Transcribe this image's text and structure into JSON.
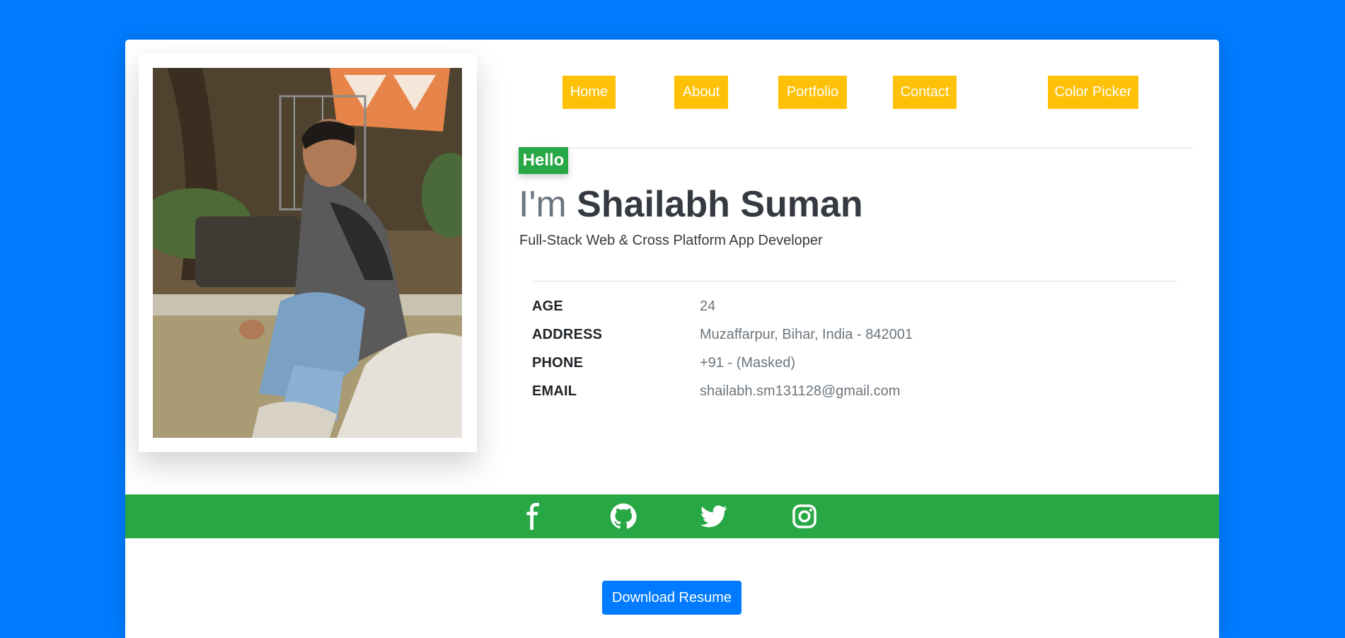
{
  "nav": {
    "items": [
      "Home",
      "About",
      "Portfolio",
      "Contact",
      "Color Picker"
    ]
  },
  "profile": {
    "photo_alt": "Profile photo",
    "greeting": "Hello",
    "im": "I'm",
    "name": "Shailabh Suman",
    "subtitle": "Full-Stack Web & Cross Platform App Developer"
  },
  "info": {
    "age_label": "AGE",
    "age_value": "24",
    "address_label": "ADDRESS",
    "address_value": "Muzaffarpur, Bihar, India - 842001",
    "phone_label": "PHONE",
    "phone_value": "+91 - (Masked)",
    "email_label": "EMAIL",
    "email_value": "shailabh.sm131128@gmail.com"
  },
  "social": {
    "icons": [
      "facebook-icon",
      "github-icon",
      "twitter-icon",
      "instagram-icon"
    ]
  },
  "actions": {
    "download_label": "Download Resume"
  },
  "colors": {
    "page_background": "#007bff",
    "nav_button": "#ffc107",
    "accent_green": "#28a745",
    "primary_button": "#007bff"
  }
}
